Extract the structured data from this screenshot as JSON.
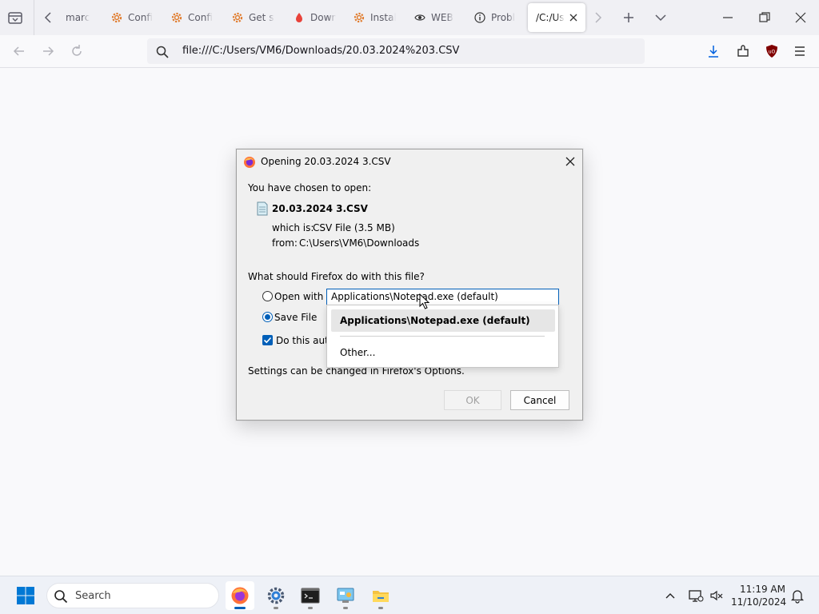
{
  "browser": {
    "tabs": [
      {
        "title": "marc",
        "icon": "tab-favicon-generic"
      },
      {
        "title": "Confi",
        "icon": "gear-orange-icon"
      },
      {
        "title": "Confi",
        "icon": "gear-orange-icon"
      },
      {
        "title": "Get st",
        "icon": "gear-orange-icon"
      },
      {
        "title": "Down",
        "icon": "drop-red-icon"
      },
      {
        "title": "Instal",
        "icon": "gear-orange-icon"
      },
      {
        "title": "WEB",
        "icon": "eye-icon"
      },
      {
        "title": "Probl",
        "icon": "info-circle-icon"
      }
    ],
    "active_tab": {
      "title": "/C:/Us"
    },
    "url": "file:///C:/Users/VM6/Downloads/20.03.2024%203.CSV"
  },
  "dialog": {
    "title": "Opening 20.03.2024 3.CSV",
    "chosen_label": "You have chosen to open:",
    "file_name": "20.03.2024 3.CSV",
    "which_is_label": "which is:",
    "which_is_value": "CSV File (3.5 MB)",
    "from_label": "from:",
    "from_value": "C:\\Users\\VM6\\Downloads",
    "question": "What should Firefox do with this file?",
    "open_with_label": "Open with",
    "open_with_value": "Applications\\Notepad.exe (default)",
    "save_file_label": "Save File",
    "do_this_label": "Do this auto",
    "settings_note": "Settings can be changed in Firefox's Options.",
    "ok_label": "OK",
    "cancel_label": "Cancel",
    "open_with_selected": false,
    "save_file_selected": true,
    "do_this_checked": true
  },
  "dropdown": {
    "options": [
      "Applications\\Notepad.exe (default)",
      "Other..."
    ],
    "selected_index": 0
  },
  "taskbar": {
    "search_placeholder": "Search",
    "apps": [
      "firefox-icon",
      "settings-gear-icon",
      "terminal-icon",
      "control-panel-icon",
      "file-explorer-icon"
    ],
    "active_app": "firefox-icon",
    "time": "11:19 AM",
    "date": "11/10/2024"
  },
  "colors": {
    "accent": "#005fb8",
    "tab_strip": "#f0f0f4",
    "dialog_bg": "#f0f0f0"
  }
}
